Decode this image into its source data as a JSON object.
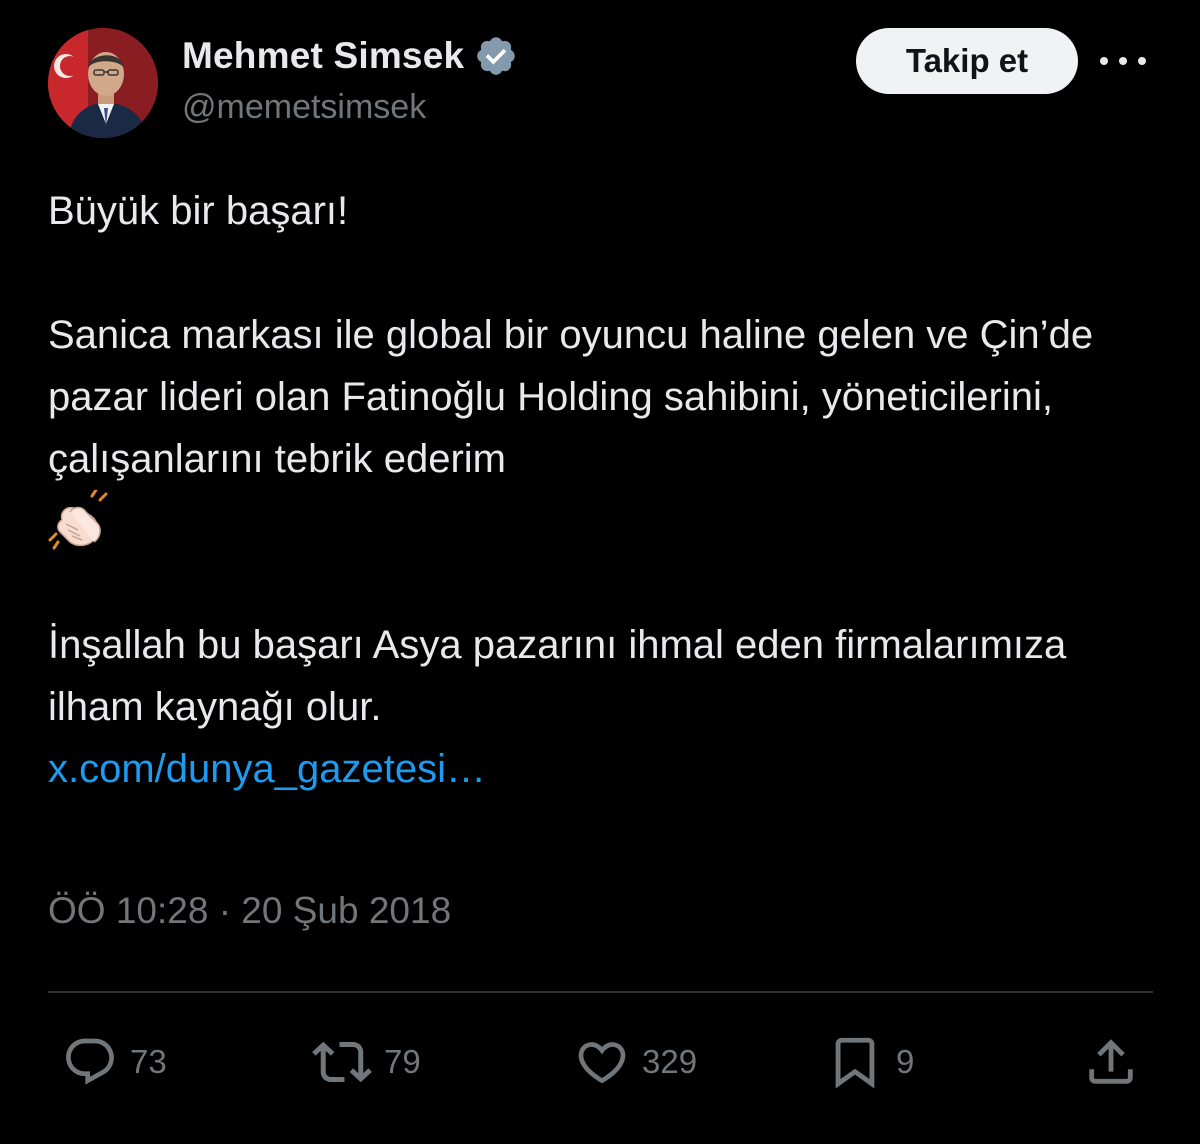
{
  "author": {
    "display_name": "Mehmet Simsek",
    "handle": "@memetsimsek",
    "verified_icon": "verified-badge-icon",
    "avatar_icon": "profile-photo"
  },
  "header": {
    "follow_label": "Takip et",
    "more_icon": "more-horizontal-icon"
  },
  "tweet": {
    "line_1": "Büyük bir başarı!",
    "paragraph_2": "Sanica markası ile global bir oyuncu haline gelen ve Çin’de pazar lideri olan Fatinoğlu Holding sahibini, yöneticilerini, çalışanlarını tebrik ederim",
    "emoji": "👏🏻",
    "paragraph_3": "İnşallah bu başarı Asya pazarını ihmal eden firmalarımıza ilham kaynağı olur.",
    "link": "x.com/dunya_gazetesi…"
  },
  "meta": {
    "timestamp": "ÖÖ 10:28 · 20 Şub 2018"
  },
  "actions": {
    "replies": "73",
    "reposts": "79",
    "likes": "329",
    "bookmarks": "9"
  },
  "colors": {
    "background": "#000000",
    "text": "#e7e9ea",
    "secondary": "#71767b",
    "link": "#1d9bf0",
    "verified": "#829aab",
    "divider": "#2f3336"
  }
}
